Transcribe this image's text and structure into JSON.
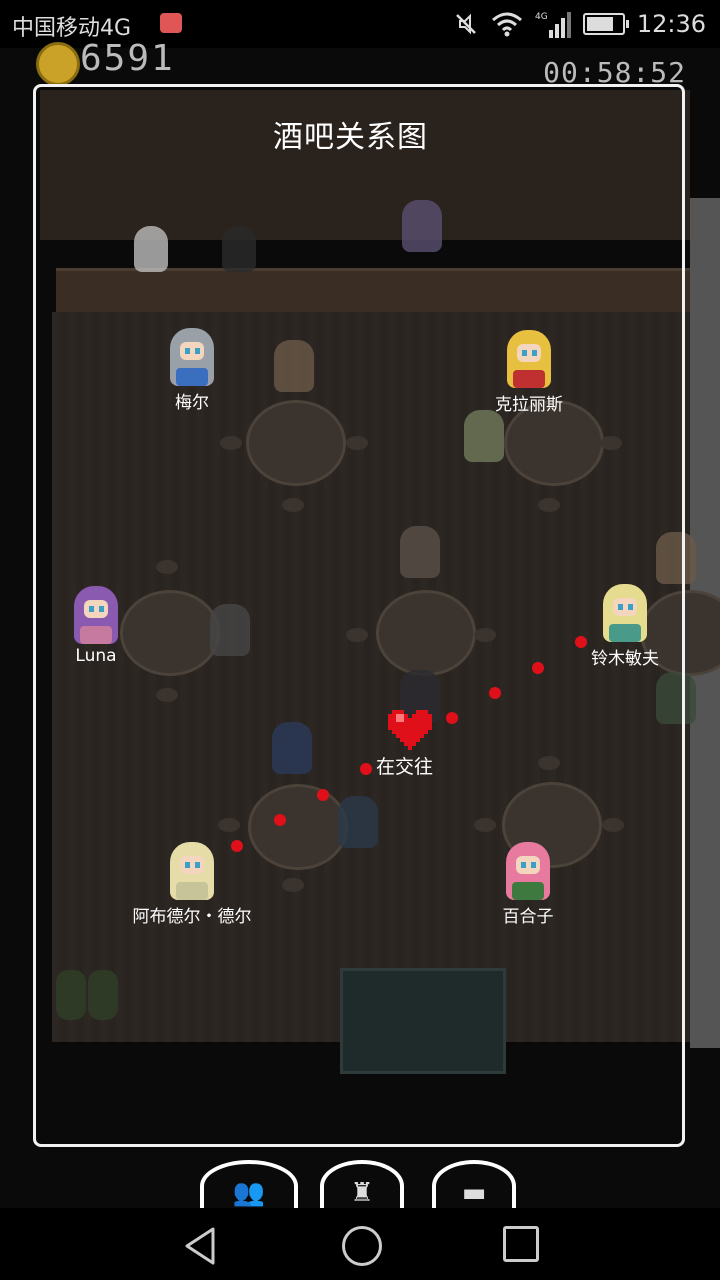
{
  "status_bar": {
    "carrier": "中国移动4G",
    "network": "4G",
    "time": "12:36",
    "icons": [
      "mail-icon",
      "mute-icon",
      "wifi-icon",
      "signal-icon",
      "battery-icon"
    ]
  },
  "hud": {
    "gold": "6591",
    "timer": "00:58:52"
  },
  "panel": {
    "title": "酒吧关系图"
  },
  "characters": [
    {
      "name": "梅尔",
      "hair": "#9aa0a8",
      "outfit": "#3a6fc0"
    },
    {
      "name": "克拉丽斯",
      "hair": "#e8c040",
      "outfit": "#c03030"
    },
    {
      "name": "Luna",
      "hair": "#8a5ab0",
      "outfit": "#c77aa0"
    },
    {
      "name": "铃木敏夫",
      "hair": "#e6dc90",
      "outfit": "#4a9a8a"
    },
    {
      "name": "阿布德尔・德尔",
      "hair": "#e6dca8",
      "outfit": "#c8c49a"
    },
    {
      "name": "百合子",
      "hair": "#e87aa0",
      "outfit": "#3e7a40"
    }
  ],
  "relationship": {
    "label": "在交往",
    "icon": "heart-icon",
    "color": "#e0101a"
  },
  "menu": {
    "buttons": [
      {
        "name": "characters-menu-button",
        "icon": "people-icon"
      },
      {
        "name": "chef-menu-button",
        "icon": "chef-icon"
      },
      {
        "name": "inventory-menu-button",
        "icon": "box-icon"
      }
    ]
  }
}
